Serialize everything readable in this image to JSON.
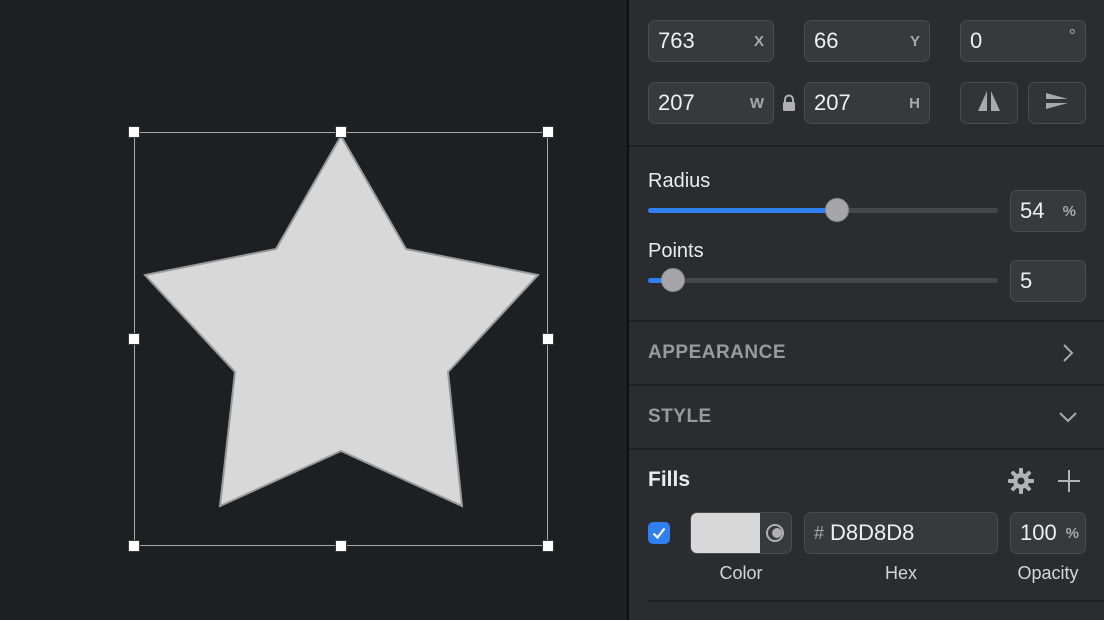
{
  "transform": {
    "x": {
      "value": "763",
      "unit": "X"
    },
    "y": {
      "value": "66",
      "unit": "Y"
    },
    "rotation": {
      "value": "0",
      "unit": "°"
    },
    "width": {
      "value": "207",
      "unit": "W"
    },
    "height": {
      "value": "207",
      "unit": "H"
    }
  },
  "shape": {
    "radius": {
      "label": "Radius",
      "value": "54",
      "unit": "%",
      "fraction": 0.54
    },
    "points": {
      "label": "Points",
      "value": "5",
      "fraction": 0.07
    }
  },
  "sections": {
    "appearance": "APPEARANCE",
    "style": "STYLE"
  },
  "fills": {
    "title": "Fills",
    "enabled": true,
    "hex_prefix": "#",
    "hex": "D8D8D8",
    "opacity": "100",
    "opacity_unit": "%",
    "color_caption": "Color",
    "hex_caption": "Hex",
    "opacity_caption": "Opacity"
  },
  "colors": {
    "star_fill": "#d8d8d8",
    "accent": "#2f7ff0",
    "canvas_bg": "#1e1f21",
    "panel_bg": "#2b2c2f"
  },
  "icons": {
    "lock": "lock-icon",
    "flip_h": "flip-horizontal-icon",
    "flip_v": "flip-vertical-icon",
    "expand": "chevron-right-icon",
    "collapse": "chevron-down-icon",
    "settings": "gear-icon",
    "add": "plus-icon",
    "color_mode": "color-picker-mode-icon",
    "check": "checkbox-check-icon"
  }
}
